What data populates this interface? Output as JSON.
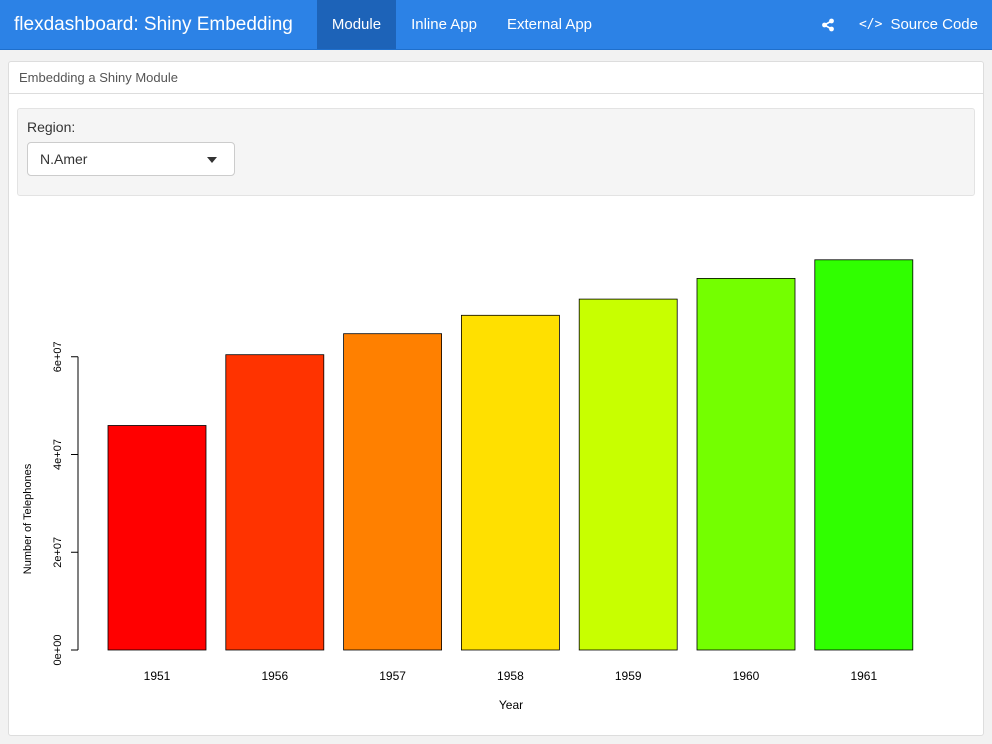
{
  "navbar": {
    "brand": "flexdashboard: Shiny Embedding",
    "tabs": [
      {
        "label": "Module",
        "active": true
      },
      {
        "label": "Inline App",
        "active": false
      },
      {
        "label": "External App",
        "active": false
      }
    ],
    "share_icon": "share-icon",
    "source_icon": "code-icon",
    "source_label": "Source Code"
  },
  "card": {
    "title": "Embedding a Shiny Module",
    "input": {
      "label": "Region:",
      "selected": "N.Amer"
    }
  },
  "colors": {
    "navbar": "#2c82e6",
    "active_tab": "#1d63b8"
  },
  "chart_data": {
    "type": "bar",
    "categories": [
      "1951",
      "1956",
      "1957",
      "1958",
      "1959",
      "1960",
      "1961"
    ],
    "values": [
      45939000,
      60423000,
      64721000,
      68484000,
      71799000,
      76036000,
      79831000
    ],
    "colors": [
      "#FF0000",
      "#FF3300",
      "#FF8000",
      "#FFE000",
      "#C8FF00",
      "#74FF00",
      "#30FF00"
    ],
    "xlabel": "Year",
    "ylabel": "Number of Telephones",
    "yticks": [
      "0e+00",
      "2e+07",
      "4e+07",
      "6e+07"
    ],
    "ytick_values": [
      0,
      20000000,
      40000000,
      60000000
    ],
    "ylim": [
      0,
      80000000
    ]
  }
}
